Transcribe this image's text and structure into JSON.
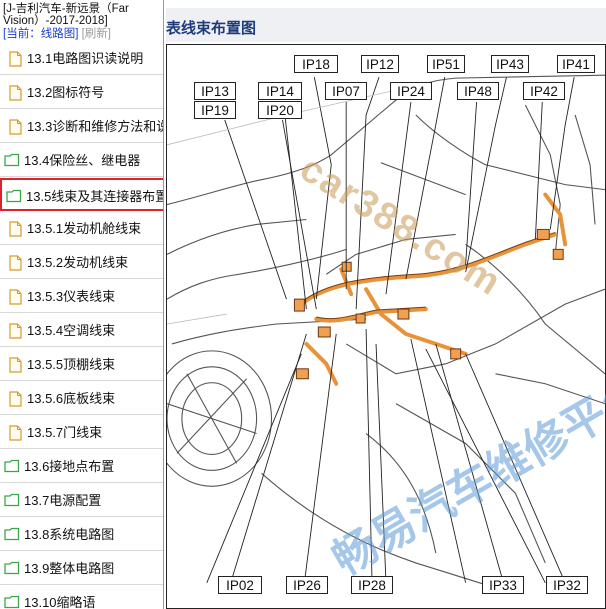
{
  "sidebar": {
    "breadcrumb": "[J-吉利汽车-新远景（Far Vision）-2017-2018]",
    "current_label": "[当前：线路图]",
    "refresh_label": "[刷新]",
    "items": [
      {
        "label": "13.1电路图识读说明",
        "type": "doc"
      },
      {
        "label": "13.2图标符号",
        "type": "doc"
      },
      {
        "label": "13.3诊断和维修方法和说明",
        "type": "doc"
      },
      {
        "label": "13.4保险丝、继电器",
        "type": "folder"
      },
      {
        "label": "13.5线束及其连接器布置",
        "type": "folder",
        "selected": true
      },
      {
        "label": "13.5.1发动机舱线束",
        "type": "doc"
      },
      {
        "label": "13.5.2发动机线束",
        "type": "doc"
      },
      {
        "label": "13.5.3仪表线束",
        "type": "doc"
      },
      {
        "label": "13.5.4空调线束",
        "type": "doc"
      },
      {
        "label": "13.5.5顶棚线束",
        "type": "doc"
      },
      {
        "label": "13.5.6底板线束",
        "type": "doc"
      },
      {
        "label": "13.5.7门线束",
        "type": "doc"
      },
      {
        "label": "13.6接地点布置",
        "type": "folder"
      },
      {
        "label": "13.7电源配置",
        "type": "folder"
      },
      {
        "label": "13.8系统电路图",
        "type": "folder"
      },
      {
        "label": "13.9整体电路图",
        "type": "folder"
      },
      {
        "label": "13.10缩略语",
        "type": "folder"
      }
    ]
  },
  "content": {
    "title": "表线束布置图",
    "watermark_text": "car388.com",
    "watermark_text_2": "畅易汽车维修平台",
    "connectors_top": [
      "IP18",
      "IP12",
      "IP51",
      "IP43",
      "IP41",
      "IP13",
      "IP14",
      "IP07",
      "IP24",
      "IP48",
      "IP42",
      "IP19",
      "IP20"
    ],
    "connectors_bottom": [
      "IP02",
      "IP26",
      "IP28",
      "IP33",
      "IP32"
    ],
    "colors": {
      "highlight": "#e0202a",
      "harness": "#e8923a",
      "title": "#1f3c7a"
    }
  }
}
